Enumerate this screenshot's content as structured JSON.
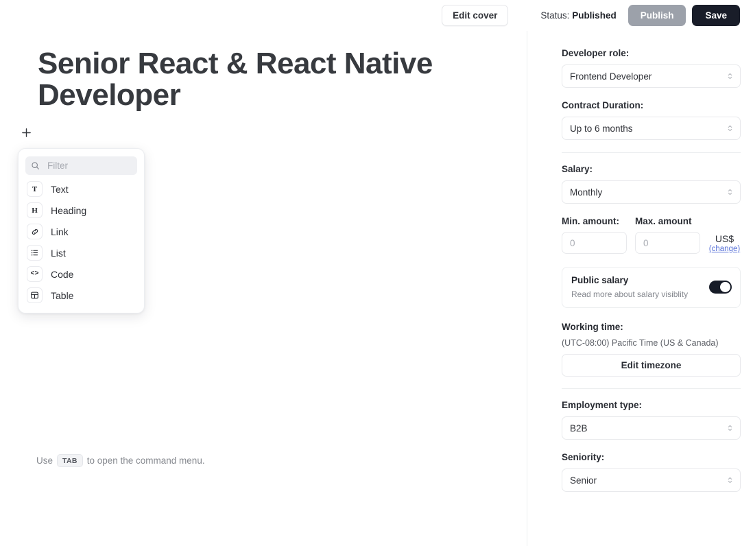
{
  "topbar": {
    "edit_cover_label": "Edit cover",
    "status_prefix": "Status:",
    "status_value": "Published",
    "publish_label": "Publish",
    "save_label": "Save"
  },
  "editor": {
    "title": "Senior React & React Native Developer",
    "add_block_glyph": "+",
    "hint_prefix": "Use",
    "hint_key": "TAB",
    "hint_suffix": "to open the command menu."
  },
  "command_menu": {
    "filter_placeholder": "Filter",
    "filter_value": "",
    "items": [
      {
        "icon": "text-icon",
        "glyph": "T",
        "label": "Text"
      },
      {
        "icon": "heading-icon",
        "glyph": "H",
        "label": "Heading"
      },
      {
        "icon": "link-icon",
        "glyph": "",
        "label": "Link"
      },
      {
        "icon": "list-icon",
        "glyph": "",
        "label": "List"
      },
      {
        "icon": "code-icon",
        "glyph": "<>",
        "label": "Code"
      },
      {
        "icon": "table-icon",
        "glyph": "",
        "label": "Table"
      }
    ]
  },
  "sidebar": {
    "developer_role": {
      "label": "Developer role:",
      "value": "Frontend Developer"
    },
    "contract_duration": {
      "label": "Contract Duration:",
      "value": "Up to 6 months"
    },
    "salary": {
      "label": "Salary:",
      "period_value": "Monthly",
      "min_label": "Min. amount:",
      "min_value": "0",
      "max_label": "Max. amount",
      "max_value": "0",
      "currency_code": "US$",
      "currency_change_label": "(change)"
    },
    "public_salary": {
      "title": "Public salary",
      "subtitle": "Read more about salary visiblity",
      "enabled": true
    },
    "working_time": {
      "label": "Working time:",
      "value": "(UTC-08:00) Pacific Time (US & Canada)",
      "button_label": "Edit timezone"
    },
    "employment_type": {
      "label": "Employment type:",
      "value": "B2B"
    },
    "seniority": {
      "label": "Seniority:",
      "value": "Senior"
    }
  },
  "colors": {
    "accent_dark": "#191d29",
    "publish_disabled": "#9ca1aa",
    "link_blue": "#5a73d8",
    "toggle_on": "#161b27"
  }
}
